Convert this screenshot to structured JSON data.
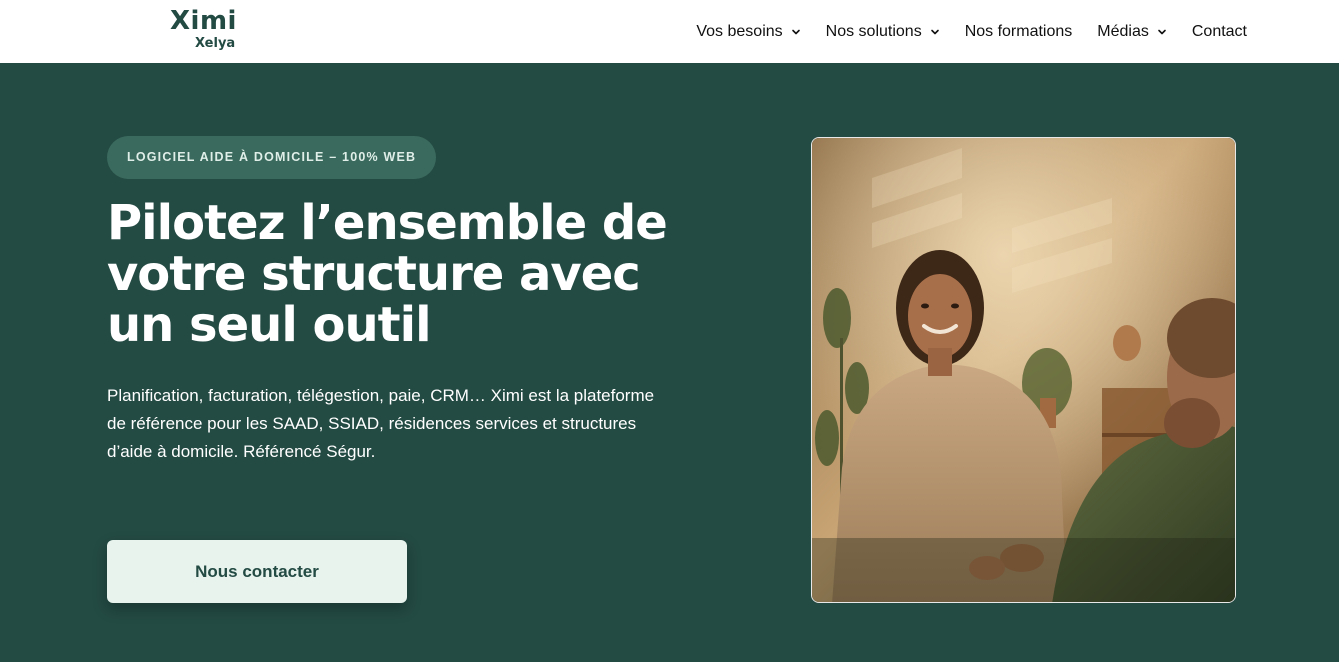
{
  "brand": {
    "name": "Ximi",
    "sub": "Xelya"
  },
  "nav": {
    "items": [
      {
        "label": "Vos besoins",
        "has_dropdown": true
      },
      {
        "label": "Nos solutions",
        "has_dropdown": true
      },
      {
        "label": "Nos formations",
        "has_dropdown": false
      },
      {
        "label": "Médias",
        "has_dropdown": true
      },
      {
        "label": "Contact",
        "has_dropdown": false
      }
    ]
  },
  "hero": {
    "badge": "LOGICIEL AIDE À DOMICILE – 100% WEB",
    "headline": "Pilotez l’ensemble de votre structure avec un seul outil",
    "description": "Planification, facturation, télégestion, paie, CRM… Ximi est la plateforme de référence pour les SAAD, SSIAD, résidences services et structures d’aide à domicile. Référencé Ségur.",
    "cta_label": "Nous contacter"
  },
  "colors": {
    "background": "#234a43",
    "badge_bg": "#3a6a5d",
    "cta_bg": "#e8f3ee",
    "brand_text": "#234a43"
  }
}
